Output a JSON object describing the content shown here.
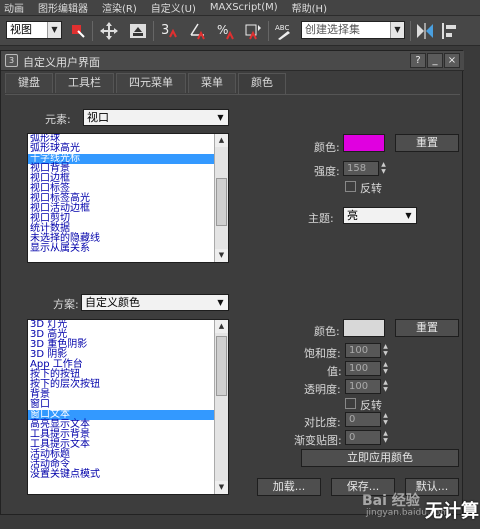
{
  "menubar": [
    "动画",
    "图形编辑器",
    "渲染(R)",
    "自定义(U)",
    "MAXScript(M)",
    "帮助(H)"
  ],
  "toolbar": {
    "view_select": "视图",
    "selection_set_placeholder": "创建选择集",
    "icons": [
      "select-object-icon",
      "move-icon",
      "render-icon",
      "snap-3-icon",
      "angle-snap-icon",
      "percent-snap-icon",
      "spinner-snap-icon",
      "edit-named-sets-icon",
      "mirror-icon",
      "align-icon"
    ]
  },
  "dialog": {
    "title": "自定义用户界面",
    "win_buttons": [
      "?",
      "_",
      "×"
    ],
    "tabs": [
      "键盘",
      "工具栏",
      "四元菜单",
      "菜单",
      "颜色"
    ],
    "active_tab": "颜色",
    "element_label": "元素:",
    "element_value": "视口",
    "element_list": [
      "弧形球",
      "弧形球高光",
      "十字线光标",
      "视口背景",
      "视口边框",
      "视口标签",
      "视口标签高光",
      "视口活动边框",
      "视口剪切",
      "统计数据",
      "未选择的隐藏线",
      "显示从属关系"
    ],
    "element_selected_index": 2,
    "color_label": "颜色:",
    "color_value": "#e000e0",
    "reset_label": "重置",
    "intensity_label": "强度:",
    "intensity_value": "158",
    "invert_label": "反转",
    "theme_label": "主题:",
    "theme_value": "亮",
    "scheme_label": "方案:",
    "scheme_value": "自定义颜色",
    "scheme_list": [
      "3D 灯光",
      "3D 高光",
      "3D 重色阴影",
      "3D 阴影",
      "App 工作台",
      "按下的按钮",
      "按下的层次按钮",
      "背景",
      "窗口",
      "窗口文本",
      "高亮显示文本",
      "工具提示背景",
      "工具提示文本",
      "活动标题",
      "活动命令",
      "没置关键点模式"
    ],
    "scheme_selected_index": 9,
    "scheme_color_label": "颜色:",
    "scheme_color_value": "#d8d8d8",
    "scheme_reset_label": "重置",
    "saturation_label": "饱和度:",
    "saturation_value": "100",
    "value_label": "值:",
    "value_value": "100",
    "transparency_label": "透明度:",
    "transparency_value": "100",
    "invert2_label": "反转",
    "contrast_label": "对比度:",
    "contrast_value": "0",
    "gradient_label": "渐变贴图:",
    "gradient_value": "0",
    "apply_label": "立即应用颜色",
    "load_label": "加载...",
    "save_label": "保存...",
    "defaults_label": "默认..."
  },
  "watermark": {
    "main": "Bai 经验",
    "sub": "jingyan.baidu.com",
    "right": "无计算"
  }
}
